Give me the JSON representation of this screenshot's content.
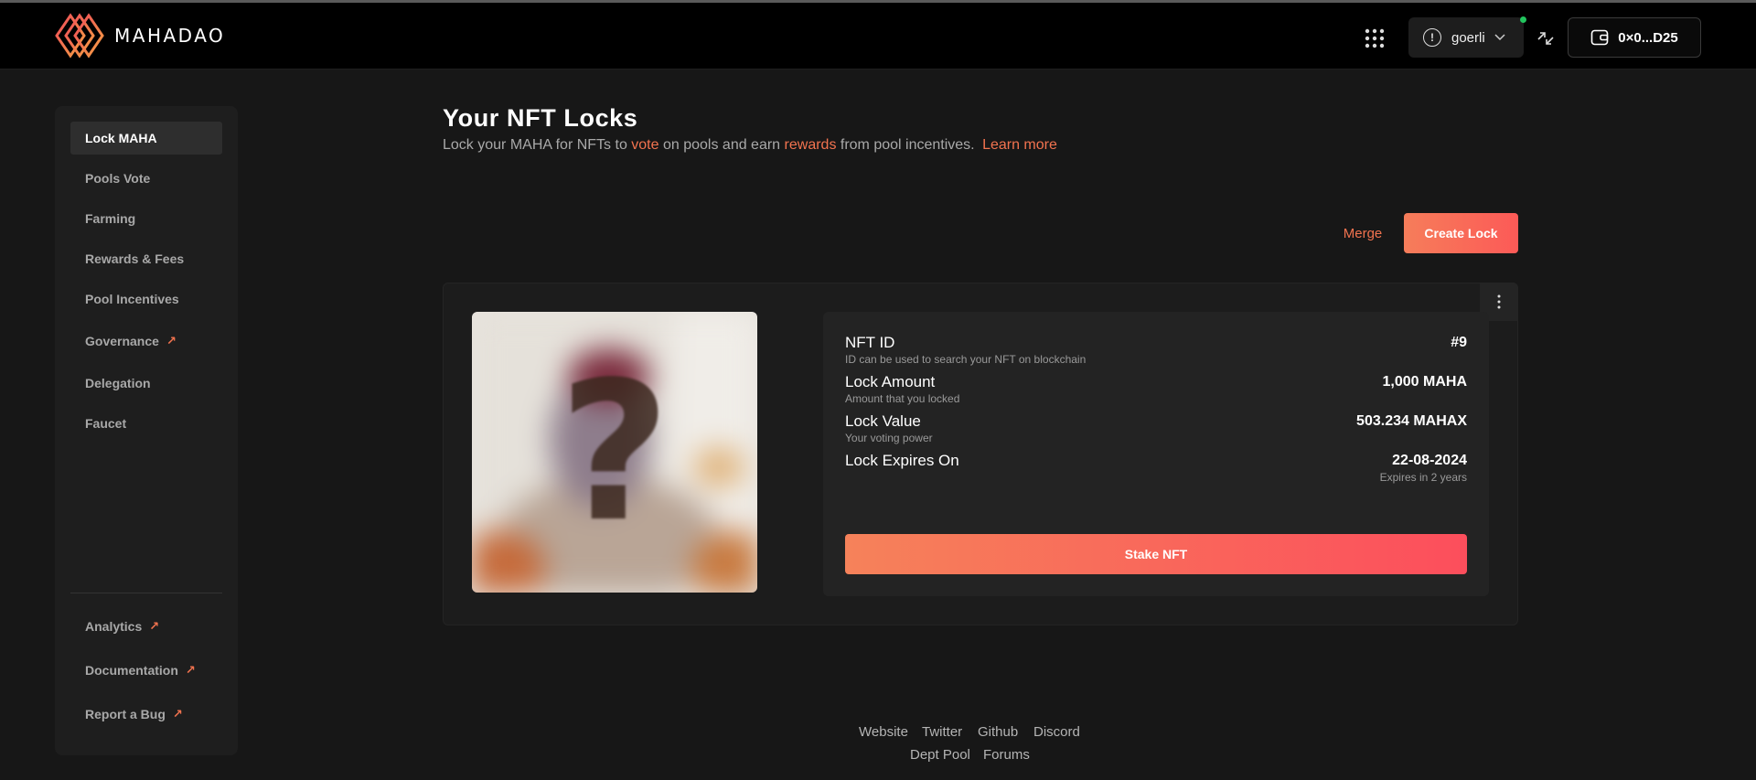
{
  "header": {
    "brand": "MAHADAO",
    "network_label": "goerli",
    "wallet_label": "0×0...D25",
    "colors": {
      "brand_red": "#f04b5a",
      "brand_orange": "#f5a142",
      "status_dot": "#22c55e"
    }
  },
  "sidebar": {
    "items": [
      {
        "label": "Lock MAHA"
      },
      {
        "label": "Pools Vote"
      },
      {
        "label": "Farming"
      },
      {
        "label": "Rewards & Fees"
      },
      {
        "label": "Pool Incentives"
      },
      {
        "label": "Governance"
      },
      {
        "label": "Delegation"
      },
      {
        "label": "Faucet"
      }
    ],
    "bottom_items": [
      {
        "label": "Analytics"
      },
      {
        "label": "Documentation"
      },
      {
        "label": "Report a Bug"
      }
    ]
  },
  "main": {
    "title": "Your NFT Locks",
    "subtitle": {
      "part1": "Lock your MAHA for NFTs to ",
      "vote": "vote",
      "part2": " on pools and earn ",
      "rewards": "rewards",
      "part3": " from pool incentives. ",
      "learn_more": "Learn more"
    },
    "merge_label": "Merge",
    "create_lock_label": "Create Lock",
    "accent_color": "#f2734f"
  },
  "lock": {
    "nft_id_label": "NFT ID",
    "nft_id_sub": "ID can be used to search your NFT on blockchain",
    "nft_id_value": "#9",
    "amount_label": "Lock Amount",
    "amount_sub": "Amount that you locked",
    "amount_value": "1,000 MAHA",
    "value_label": "Lock Value",
    "value_sub": "Your voting power",
    "value_value": "503.234 MAHAX",
    "expires_label": "Lock Expires On",
    "expires_value": "22-08-2024",
    "expires_sub": "Expires in 2 years",
    "stake_label": "Stake NFT"
  },
  "footer": {
    "links_row1": [
      "Website",
      "Twitter",
      "Github",
      "Discord"
    ],
    "links_row2": [
      "Dept Pool",
      "Forums"
    ]
  }
}
